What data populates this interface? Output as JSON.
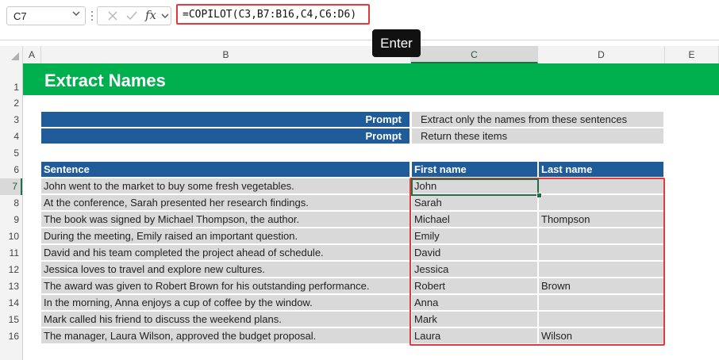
{
  "formula_bar": {
    "name_box": "C7",
    "fx_label": "fx",
    "formula": "=COPILOT(C3,B7:B16,C4,C6:D6)"
  },
  "tooltip": "Enter",
  "columns": [
    "A",
    "B",
    "C",
    "D",
    "E"
  ],
  "rows": [
    "1",
    "2",
    "3",
    "4",
    "5",
    "6",
    "7",
    "8",
    "9",
    "10",
    "11",
    "12",
    "13",
    "14",
    "15",
    "16"
  ],
  "sheet": {
    "title": "Extract Names",
    "prompts": [
      {
        "label": "Prompt",
        "value": "Extract only the names from these sentences"
      },
      {
        "label": "Prompt",
        "value": "Return these items"
      }
    ],
    "headers": {
      "sentence": "Sentence",
      "first": "First name",
      "last": "Last name"
    },
    "table": [
      {
        "sentence": "John went to the market to buy some fresh vegetables.",
        "first": "John",
        "last": ""
      },
      {
        "sentence": "At the conference, Sarah presented her research findings.",
        "first": "Sarah",
        "last": ""
      },
      {
        "sentence": "The book was signed by Michael Thompson, the author.",
        "first": "Michael",
        "last": "Thompson"
      },
      {
        "sentence": "During the meeting, Emily raised an important question.",
        "first": "Emily",
        "last": ""
      },
      {
        "sentence": "David and his team completed the project ahead of schedule.",
        "first": "David",
        "last": ""
      },
      {
        "sentence": "Jessica loves to travel and explore new cultures.",
        "first": "Jessica",
        "last": ""
      },
      {
        "sentence": "The award was given to Robert Brown for his outstanding performance.",
        "first": "Robert",
        "last": "Brown"
      },
      {
        "sentence": "In the morning, Anna enjoys a cup of coffee by the window.",
        "first": "Anna",
        "last": ""
      },
      {
        "sentence": "Mark called his friend to discuss the weekend plans.",
        "first": "Mark",
        "last": ""
      },
      {
        "sentence": "The manager, Laura Wilson, approved the budget proposal.",
        "first": "Laura",
        "last": "Wilson"
      }
    ]
  },
  "selection": {
    "cell": "C7",
    "column": "C",
    "row": "7"
  },
  "colors": {
    "title_band": "#00b04f",
    "header_blue": "#1f5c99",
    "cell_gray": "#d9d9d9",
    "highlight_red": "#e33b3b",
    "select_green": "#1e7145"
  },
  "icons": [
    "chevron-down-icon",
    "cancel-x-icon",
    "check-icon",
    "function-icon",
    "select-all-icon"
  ]
}
